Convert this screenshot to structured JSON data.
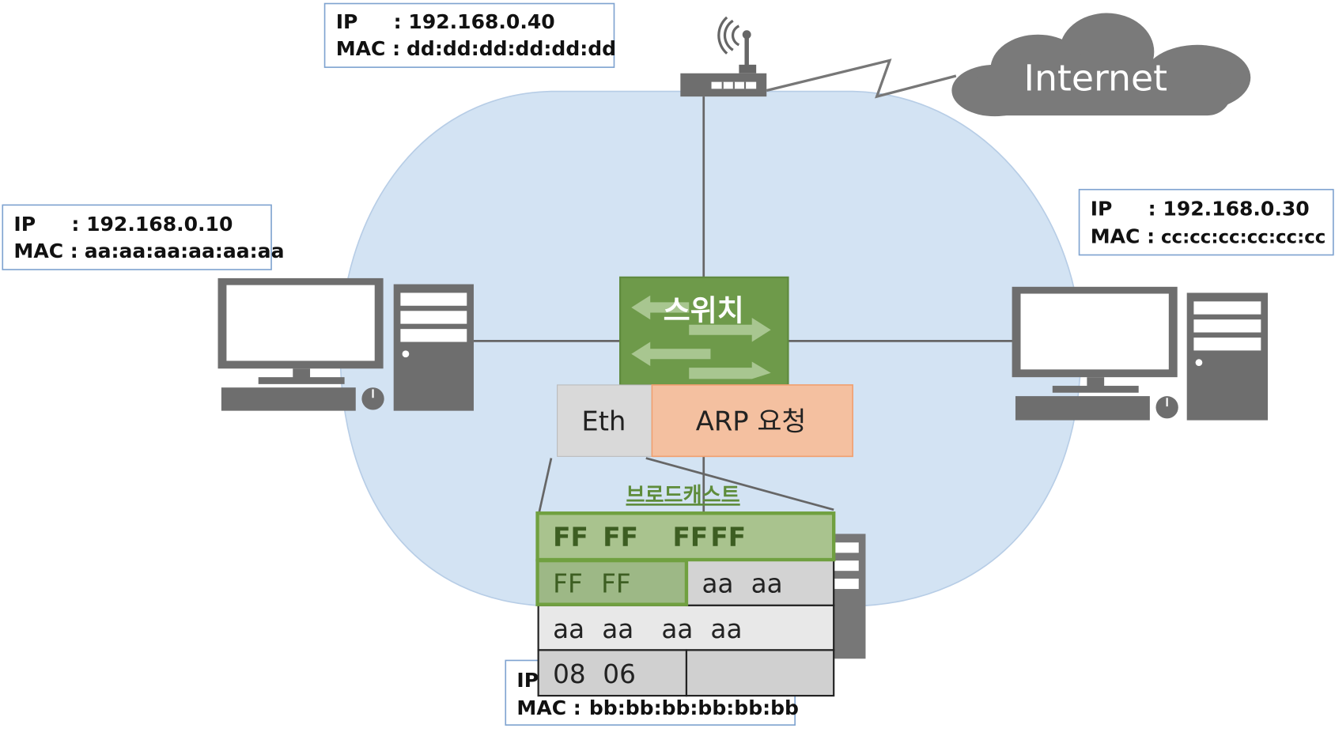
{
  "router_info": {
    "ip_label": "IP",
    "ip": ": 192.168.0.40",
    "mac_label": "MAC :",
    "mac": "dd:dd:dd:dd:dd:dd"
  },
  "host_a_info": {
    "ip_label": "IP",
    "ip": ": 192.168.0.10",
    "mac_label": "MAC :",
    "mac": "aa:aa:aa:aa:aa:aa"
  },
  "host_c_info": {
    "ip_label": "IP",
    "ip": ": 192.168.0.30",
    "mac_label": "MAC :",
    "mac": "cc:cc:cc:cc:cc:cc"
  },
  "host_b_info": {
    "ip_label": "IP",
    "mac_label": "MAC :",
    "mac": "bb:bb:bb:bb:bb:bb"
  },
  "internet_label": "Internet",
  "switch_label": "스위치",
  "packet": {
    "eth": "Eth",
    "payload": "ARP 요청"
  },
  "broadcast_label": "브로드캐스트",
  "frame": {
    "row1": [
      "FF",
      "FF",
      "FF",
      "FF"
    ],
    "row2_left": [
      "FF",
      "FF"
    ],
    "row2_right": [
      "aa",
      "aa"
    ],
    "row3": [
      "aa",
      "aa",
      "aa",
      "aa"
    ],
    "row4_left": [
      "08",
      "06"
    ]
  },
  "colors": {
    "lan": "#d3e3f3",
    "switch": "#6e9a4a",
    "broadcast": "#5e8c3a",
    "device": "#777777",
    "arp": "#f4c0a0"
  }
}
